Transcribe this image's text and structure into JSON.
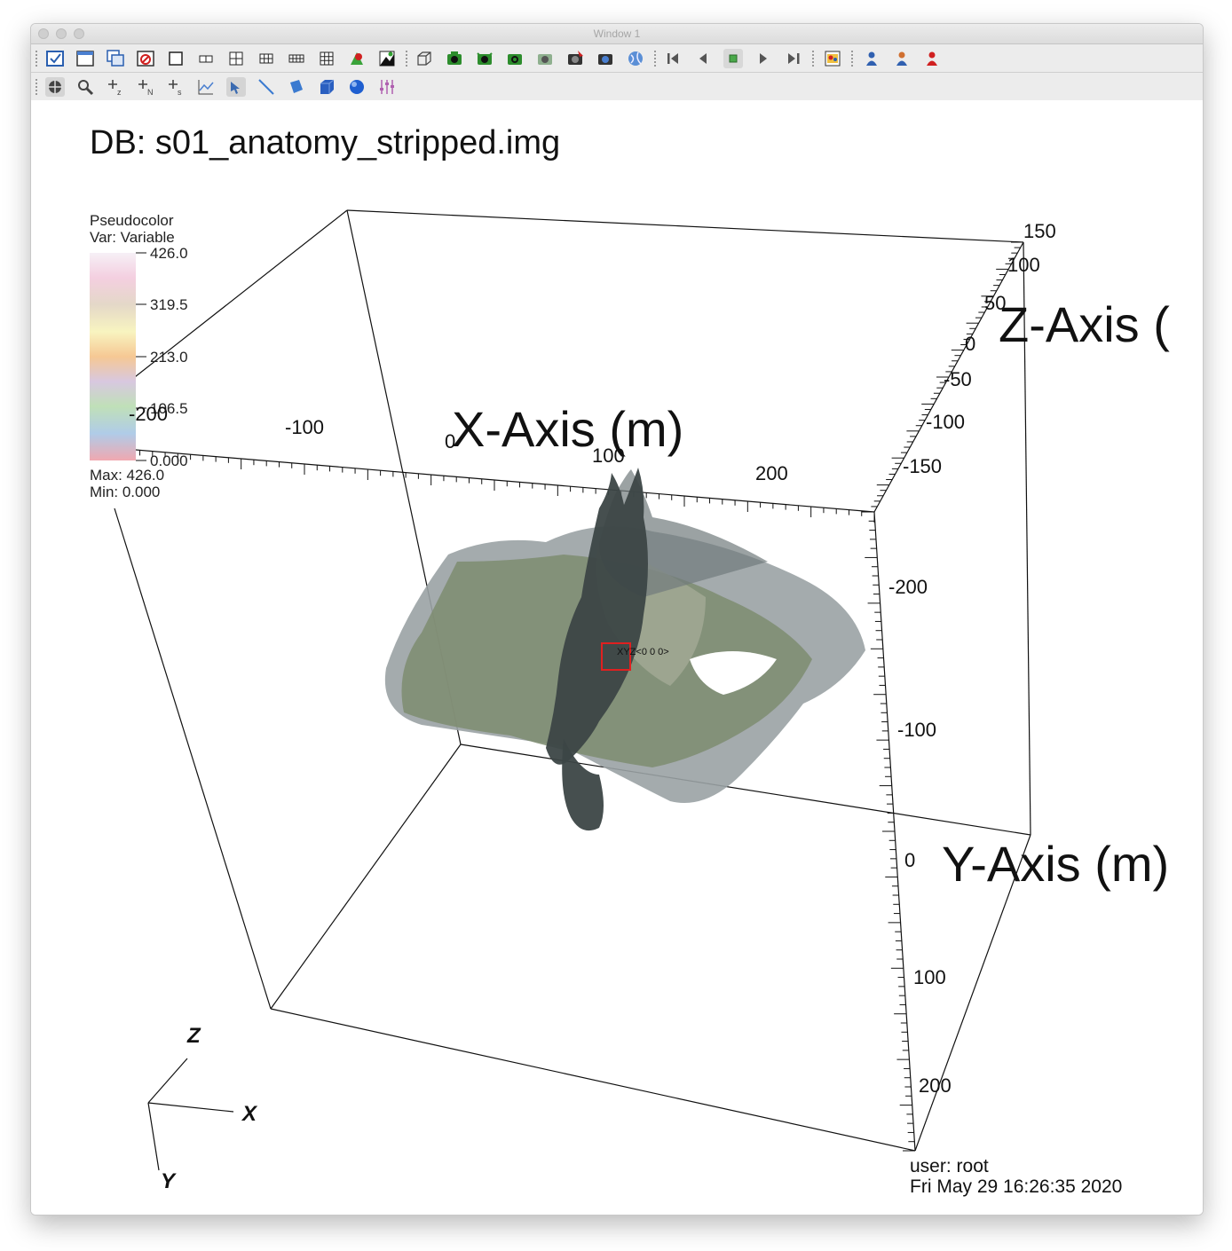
{
  "window": {
    "title": "Window 1"
  },
  "toolbar1": [
    "active-window-icon",
    "new-window-icon",
    "clone-window-icon",
    "delete-window-icon",
    "layout-1x1-icon",
    "layout-1x2-icon",
    "layout-2x2-icon",
    "layout-2x3-icon",
    "layout-2x4-icon",
    "layout-3x3-icon",
    "invert-background-icon",
    "set-mode-icon",
    "box-view-icon",
    "draw-plots-icon",
    "clear-plots-icon",
    "save-image-icon",
    "snapshot-icon",
    "copy-view-icon",
    "lock-view-icon",
    "lock-time-icon",
    "first-frame-icon",
    "prev-frame-icon",
    "stop-icon",
    "play-icon",
    "next-frame-icon",
    "view-setting-icon",
    "add-plot-icon",
    "add-operator-icon",
    "remove-icon"
  ],
  "toolbar2": [
    "navigate-icon",
    "zoom-icon",
    "pick-zone-icon",
    "pick-node-icon",
    "pick-s-icon",
    "lineout-icon",
    "pick-pointer-icon",
    "line-tool-icon",
    "plane-tool-icon",
    "box-tool-icon",
    "sphere-tool-icon",
    "axis-tool-icon"
  ],
  "plot": {
    "db_title": "DB: s01_anatomy_stripped.img",
    "legend": {
      "plot_type": "Pseudocolor",
      "var": "Var: Variable",
      "ticks": [
        "426.0",
        "319.5",
        "213.0",
        "106.5",
        "0.000"
      ],
      "max": "Max:  426.0",
      "min": "Min:  0.000"
    },
    "x_axis": {
      "label": "X-Axis (m)",
      "ticks": [
        "-200",
        "-100",
        "0",
        "100",
        "200"
      ]
    },
    "y_axis": {
      "label": "Y-Axis (m)",
      "ticks": [
        "-200",
        "-100",
        "0",
        "100",
        "200"
      ]
    },
    "z_axis": {
      "label": "Z-Axis (",
      "ticks": [
        "150",
        "100",
        "50",
        "0",
        "-50",
        "-100",
        "-150"
      ]
    },
    "probe": {
      "label": "XYZ<0 0 0>"
    },
    "triad": {
      "x": "X",
      "y": "Y",
      "z": "Z"
    },
    "user": "user: root",
    "timestamp": "Fri May 29 16:26:35 2020"
  },
  "colors": {
    "titlebar": "#dcdcdc",
    "toolbar": "#ececec",
    "slice_dark": "#3c4646",
    "slice_green": "#7e8c70",
    "slice_gray": "#9aa2a4",
    "probe_box": "#e02020"
  }
}
